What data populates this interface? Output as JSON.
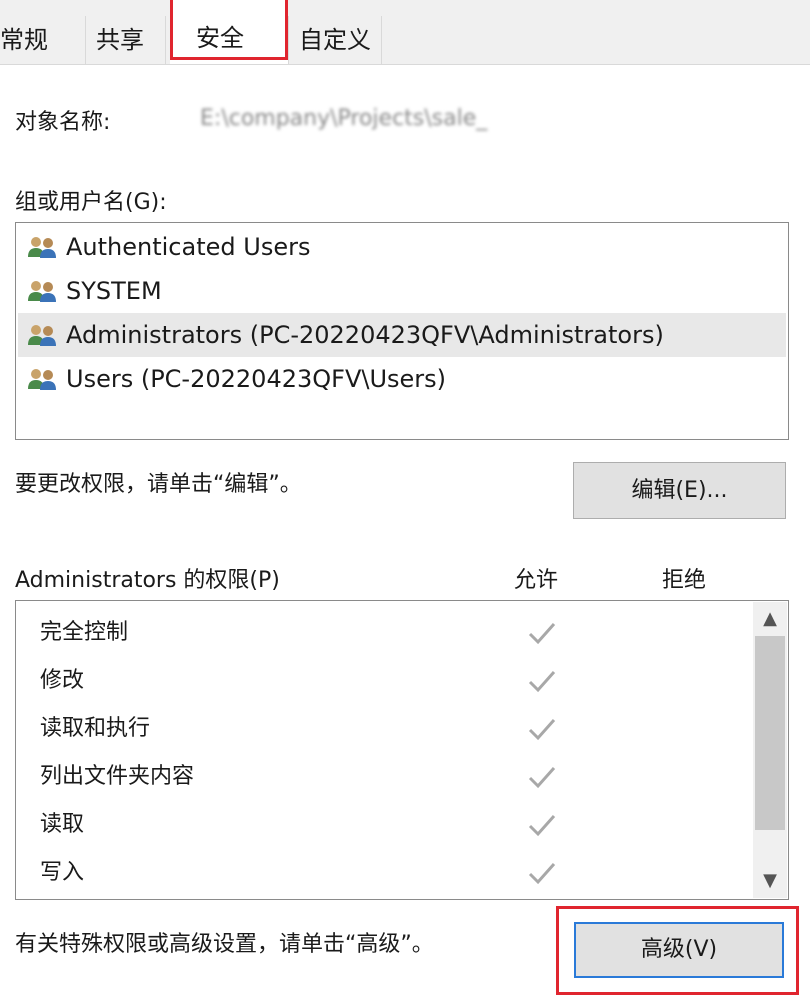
{
  "tabs": [
    "常规",
    "共享",
    "安全",
    "自定义"
  ],
  "object_name_label": "对象名称:",
  "object_name_value": "E:\\company\\Projects\\sale_",
  "group_label": "组或用户名(G):",
  "users": [
    {
      "name": "Authenticated Users",
      "icon": "users-icon"
    },
    {
      "name": "SYSTEM",
      "icon": "users-icon"
    },
    {
      "name": "Administrators (PC-20220423QFV\\Administrators)",
      "icon": "users-icon"
    },
    {
      "name": "Users (PC-20220423QFV\\Users)",
      "icon": "users-icon"
    }
  ],
  "edit_hint": "要更改权限，请单击“编辑”。",
  "edit_button": "编辑(E)...",
  "perm_header": {
    "title": "Administrators 的权限(P)",
    "allow": "允许",
    "deny": "拒绝"
  },
  "permissions": [
    {
      "name": "完全控制",
      "allow": true,
      "deny": false
    },
    {
      "name": "修改",
      "allow": true,
      "deny": false
    },
    {
      "name": "读取和执行",
      "allow": true,
      "deny": false
    },
    {
      "name": "列出文件夹内容",
      "allow": true,
      "deny": false
    },
    {
      "name": "读取",
      "allow": true,
      "deny": false
    },
    {
      "name": "写入",
      "allow": true,
      "deny": false
    }
  ],
  "advanced_hint": "有关特殊权限或高级设置，请单击“高级”。",
  "advanced_button": "高级(V)",
  "colors": {
    "highlight_red": "#e0252f",
    "focus_blue": "#2a7ad8",
    "check_gray": "#a8a8a8"
  }
}
